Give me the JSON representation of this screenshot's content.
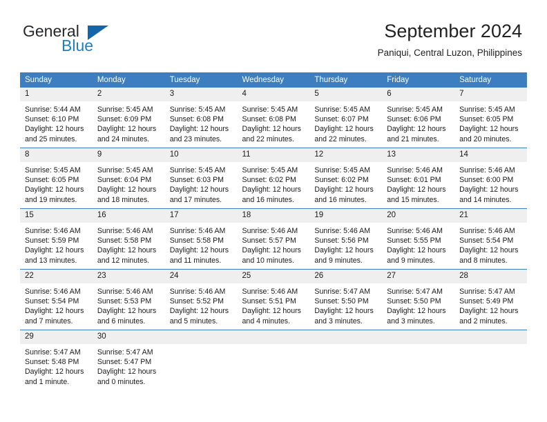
{
  "logo": {
    "word_one": "General",
    "word_two": "Blue"
  },
  "header": {
    "title": "September 2024",
    "location": "Paniqui, Central Luzon, Philippines"
  },
  "calendar": {
    "weekday_headers": [
      "Sunday",
      "Monday",
      "Tuesday",
      "Wednesday",
      "Thursday",
      "Friday",
      "Saturday"
    ],
    "colors": {
      "header_background": "#3c7ebf",
      "header_text": "#ffffff",
      "daynumber_background": "#efefef",
      "cell_background": "#ffffff",
      "rule": "#3c7ebf",
      "logo_blue": "#1f7fc4",
      "logo_flag": "#1464aa"
    },
    "weeks": [
      [
        {
          "day": "1",
          "sunrise": "Sunrise: 5:44 AM",
          "sunset": "Sunset: 6:10 PM",
          "daylight_line1": "Daylight: 12 hours",
          "daylight_line2": "and 25 minutes."
        },
        {
          "day": "2",
          "sunrise": "Sunrise: 5:45 AM",
          "sunset": "Sunset: 6:09 PM",
          "daylight_line1": "Daylight: 12 hours",
          "daylight_line2": "and 24 minutes."
        },
        {
          "day": "3",
          "sunrise": "Sunrise: 5:45 AM",
          "sunset": "Sunset: 6:08 PM",
          "daylight_line1": "Daylight: 12 hours",
          "daylight_line2": "and 23 minutes."
        },
        {
          "day": "4",
          "sunrise": "Sunrise: 5:45 AM",
          "sunset": "Sunset: 6:08 PM",
          "daylight_line1": "Daylight: 12 hours",
          "daylight_line2": "and 22 minutes."
        },
        {
          "day": "5",
          "sunrise": "Sunrise: 5:45 AM",
          "sunset": "Sunset: 6:07 PM",
          "daylight_line1": "Daylight: 12 hours",
          "daylight_line2": "and 22 minutes."
        },
        {
          "day": "6",
          "sunrise": "Sunrise: 5:45 AM",
          "sunset": "Sunset: 6:06 PM",
          "daylight_line1": "Daylight: 12 hours",
          "daylight_line2": "and 21 minutes."
        },
        {
          "day": "7",
          "sunrise": "Sunrise: 5:45 AM",
          "sunset": "Sunset: 6:05 PM",
          "daylight_line1": "Daylight: 12 hours",
          "daylight_line2": "and 20 minutes."
        }
      ],
      [
        {
          "day": "8",
          "sunrise": "Sunrise: 5:45 AM",
          "sunset": "Sunset: 6:05 PM",
          "daylight_line1": "Daylight: 12 hours",
          "daylight_line2": "and 19 minutes."
        },
        {
          "day": "9",
          "sunrise": "Sunrise: 5:45 AM",
          "sunset": "Sunset: 6:04 PM",
          "daylight_line1": "Daylight: 12 hours",
          "daylight_line2": "and 18 minutes."
        },
        {
          "day": "10",
          "sunrise": "Sunrise: 5:45 AM",
          "sunset": "Sunset: 6:03 PM",
          "daylight_line1": "Daylight: 12 hours",
          "daylight_line2": "and 17 minutes."
        },
        {
          "day": "11",
          "sunrise": "Sunrise: 5:45 AM",
          "sunset": "Sunset: 6:02 PM",
          "daylight_line1": "Daylight: 12 hours",
          "daylight_line2": "and 16 minutes."
        },
        {
          "day": "12",
          "sunrise": "Sunrise: 5:45 AM",
          "sunset": "Sunset: 6:02 PM",
          "daylight_line1": "Daylight: 12 hours",
          "daylight_line2": "and 16 minutes."
        },
        {
          "day": "13",
          "sunrise": "Sunrise: 5:46 AM",
          "sunset": "Sunset: 6:01 PM",
          "daylight_line1": "Daylight: 12 hours",
          "daylight_line2": "and 15 minutes."
        },
        {
          "day": "14",
          "sunrise": "Sunrise: 5:46 AM",
          "sunset": "Sunset: 6:00 PM",
          "daylight_line1": "Daylight: 12 hours",
          "daylight_line2": "and 14 minutes."
        }
      ],
      [
        {
          "day": "15",
          "sunrise": "Sunrise: 5:46 AM",
          "sunset": "Sunset: 5:59 PM",
          "daylight_line1": "Daylight: 12 hours",
          "daylight_line2": "and 13 minutes."
        },
        {
          "day": "16",
          "sunrise": "Sunrise: 5:46 AM",
          "sunset": "Sunset: 5:58 PM",
          "daylight_line1": "Daylight: 12 hours",
          "daylight_line2": "and 12 minutes."
        },
        {
          "day": "17",
          "sunrise": "Sunrise: 5:46 AM",
          "sunset": "Sunset: 5:58 PM",
          "daylight_line1": "Daylight: 12 hours",
          "daylight_line2": "and 11 minutes."
        },
        {
          "day": "18",
          "sunrise": "Sunrise: 5:46 AM",
          "sunset": "Sunset: 5:57 PM",
          "daylight_line1": "Daylight: 12 hours",
          "daylight_line2": "and 10 minutes."
        },
        {
          "day": "19",
          "sunrise": "Sunrise: 5:46 AM",
          "sunset": "Sunset: 5:56 PM",
          "daylight_line1": "Daylight: 12 hours",
          "daylight_line2": "and 9 minutes."
        },
        {
          "day": "20",
          "sunrise": "Sunrise: 5:46 AM",
          "sunset": "Sunset: 5:55 PM",
          "daylight_line1": "Daylight: 12 hours",
          "daylight_line2": "and 9 minutes."
        },
        {
          "day": "21",
          "sunrise": "Sunrise: 5:46 AM",
          "sunset": "Sunset: 5:54 PM",
          "daylight_line1": "Daylight: 12 hours",
          "daylight_line2": "and 8 minutes."
        }
      ],
      [
        {
          "day": "22",
          "sunrise": "Sunrise: 5:46 AM",
          "sunset": "Sunset: 5:54 PM",
          "daylight_line1": "Daylight: 12 hours",
          "daylight_line2": "and 7 minutes."
        },
        {
          "day": "23",
          "sunrise": "Sunrise: 5:46 AM",
          "sunset": "Sunset: 5:53 PM",
          "daylight_line1": "Daylight: 12 hours",
          "daylight_line2": "and 6 minutes."
        },
        {
          "day": "24",
          "sunrise": "Sunrise: 5:46 AM",
          "sunset": "Sunset: 5:52 PM",
          "daylight_line1": "Daylight: 12 hours",
          "daylight_line2": "and 5 minutes."
        },
        {
          "day": "25",
          "sunrise": "Sunrise: 5:46 AM",
          "sunset": "Sunset: 5:51 PM",
          "daylight_line1": "Daylight: 12 hours",
          "daylight_line2": "and 4 minutes."
        },
        {
          "day": "26",
          "sunrise": "Sunrise: 5:47 AM",
          "sunset": "Sunset: 5:50 PM",
          "daylight_line1": "Daylight: 12 hours",
          "daylight_line2": "and 3 minutes."
        },
        {
          "day": "27",
          "sunrise": "Sunrise: 5:47 AM",
          "sunset": "Sunset: 5:50 PM",
          "daylight_line1": "Daylight: 12 hours",
          "daylight_line2": "and 3 minutes."
        },
        {
          "day": "28",
          "sunrise": "Sunrise: 5:47 AM",
          "sunset": "Sunset: 5:49 PM",
          "daylight_line1": "Daylight: 12 hours",
          "daylight_line2": "and 2 minutes."
        }
      ],
      [
        {
          "day": "29",
          "sunrise": "Sunrise: 5:47 AM",
          "sunset": "Sunset: 5:48 PM",
          "daylight_line1": "Daylight: 12 hours",
          "daylight_line2": "and 1 minute."
        },
        {
          "day": "30",
          "sunrise": "Sunrise: 5:47 AM",
          "sunset": "Sunset: 5:47 PM",
          "daylight_line1": "Daylight: 12 hours",
          "daylight_line2": "and 0 minutes."
        },
        {
          "day": "",
          "sunrise": "",
          "sunset": "",
          "daylight_line1": "",
          "daylight_line2": ""
        },
        {
          "day": "",
          "sunrise": "",
          "sunset": "",
          "daylight_line1": "",
          "daylight_line2": ""
        },
        {
          "day": "",
          "sunrise": "",
          "sunset": "",
          "daylight_line1": "",
          "daylight_line2": ""
        },
        {
          "day": "",
          "sunrise": "",
          "sunset": "",
          "daylight_line1": "",
          "daylight_line2": ""
        },
        {
          "day": "",
          "sunrise": "",
          "sunset": "",
          "daylight_line1": "",
          "daylight_line2": ""
        }
      ]
    ]
  }
}
